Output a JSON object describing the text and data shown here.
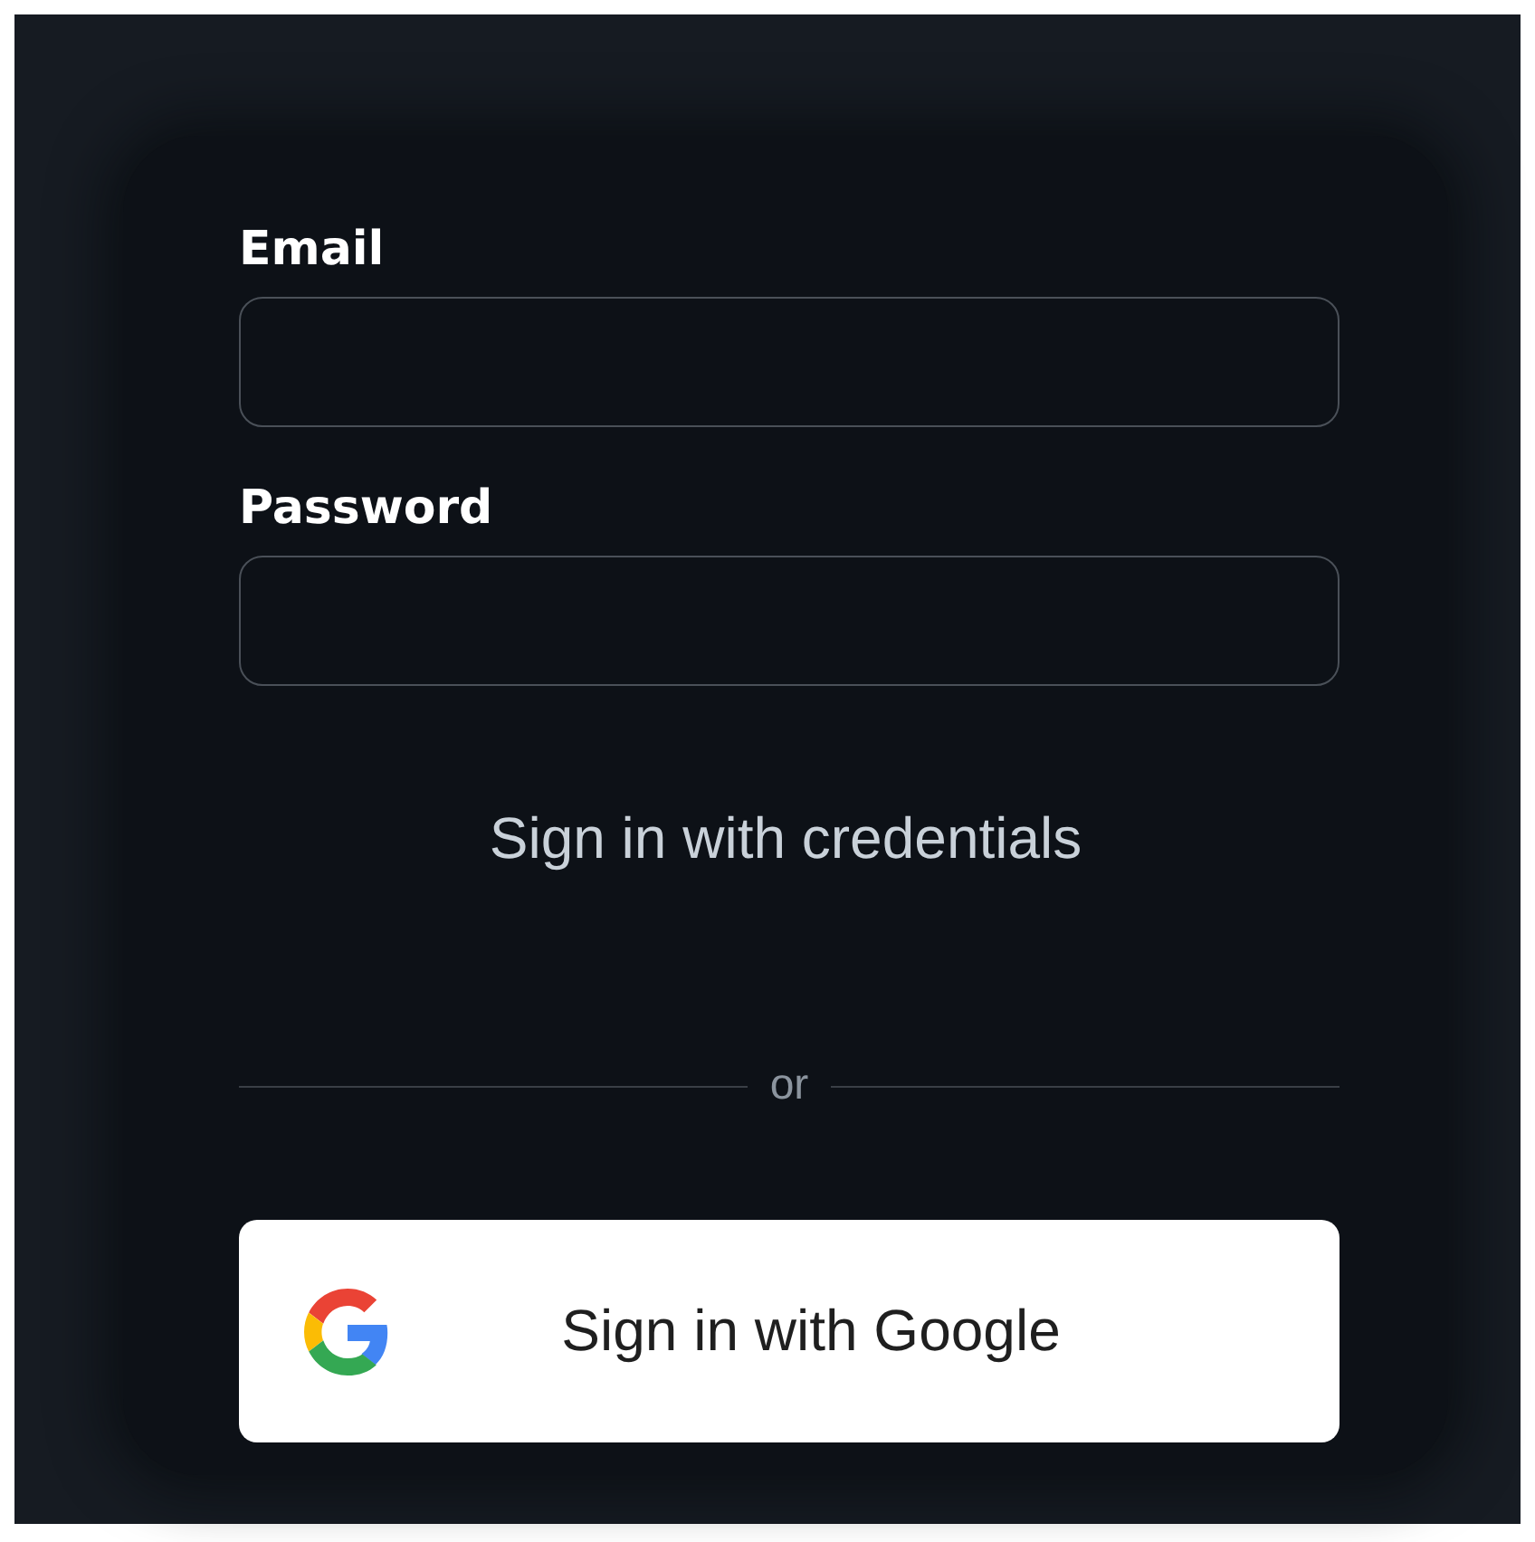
{
  "fields": [
    {
      "label": "Email"
    },
    {
      "label": "Password"
    }
  ],
  "credentials_button": "Sign in with credentials",
  "divider": "or",
  "google_button": "Sign in with Google"
}
